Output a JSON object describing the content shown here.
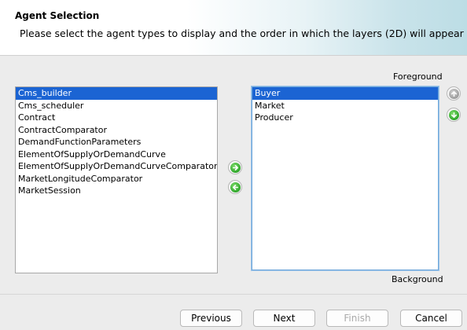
{
  "header": {
    "title": "Agent Selection",
    "subtitle": "Please select the agent types to display and the order in which the layers (2D) will appear"
  },
  "labels": {
    "foreground": "Foreground",
    "background": "Background"
  },
  "available_list": {
    "items": [
      {
        "label": "Cms_builder",
        "selected": true
      },
      {
        "label": "Cms_scheduler",
        "selected": false
      },
      {
        "label": "Contract",
        "selected": false
      },
      {
        "label": "ContractComparator",
        "selected": false
      },
      {
        "label": "DemandFunctionParameters",
        "selected": false
      },
      {
        "label": "ElementOfSupplyOrDemandCurve",
        "selected": false
      },
      {
        "label": "ElementOfSupplyOrDemandCurveComparator",
        "selected": false
      },
      {
        "label": "MarketLongitudeComparator",
        "selected": false
      },
      {
        "label": "MarketSession",
        "selected": false
      }
    ]
  },
  "selected_list": {
    "items": [
      {
        "label": "Buyer",
        "selected": true
      },
      {
        "label": "Market",
        "selected": false
      },
      {
        "label": "Producer",
        "selected": false
      }
    ]
  },
  "icons": {
    "add": "arrow-right-icon",
    "remove": "arrow-left-icon",
    "move_up": "arrow-up-icon",
    "move_down": "arrow-down-icon"
  },
  "colors": {
    "selection": "#1b64d3",
    "arrow_green": "#2ea52a",
    "focus_border": "#6fa7d9"
  },
  "buttons": {
    "previous": "Previous",
    "next": "Next",
    "finish": "Finish",
    "cancel": "Cancel"
  }
}
